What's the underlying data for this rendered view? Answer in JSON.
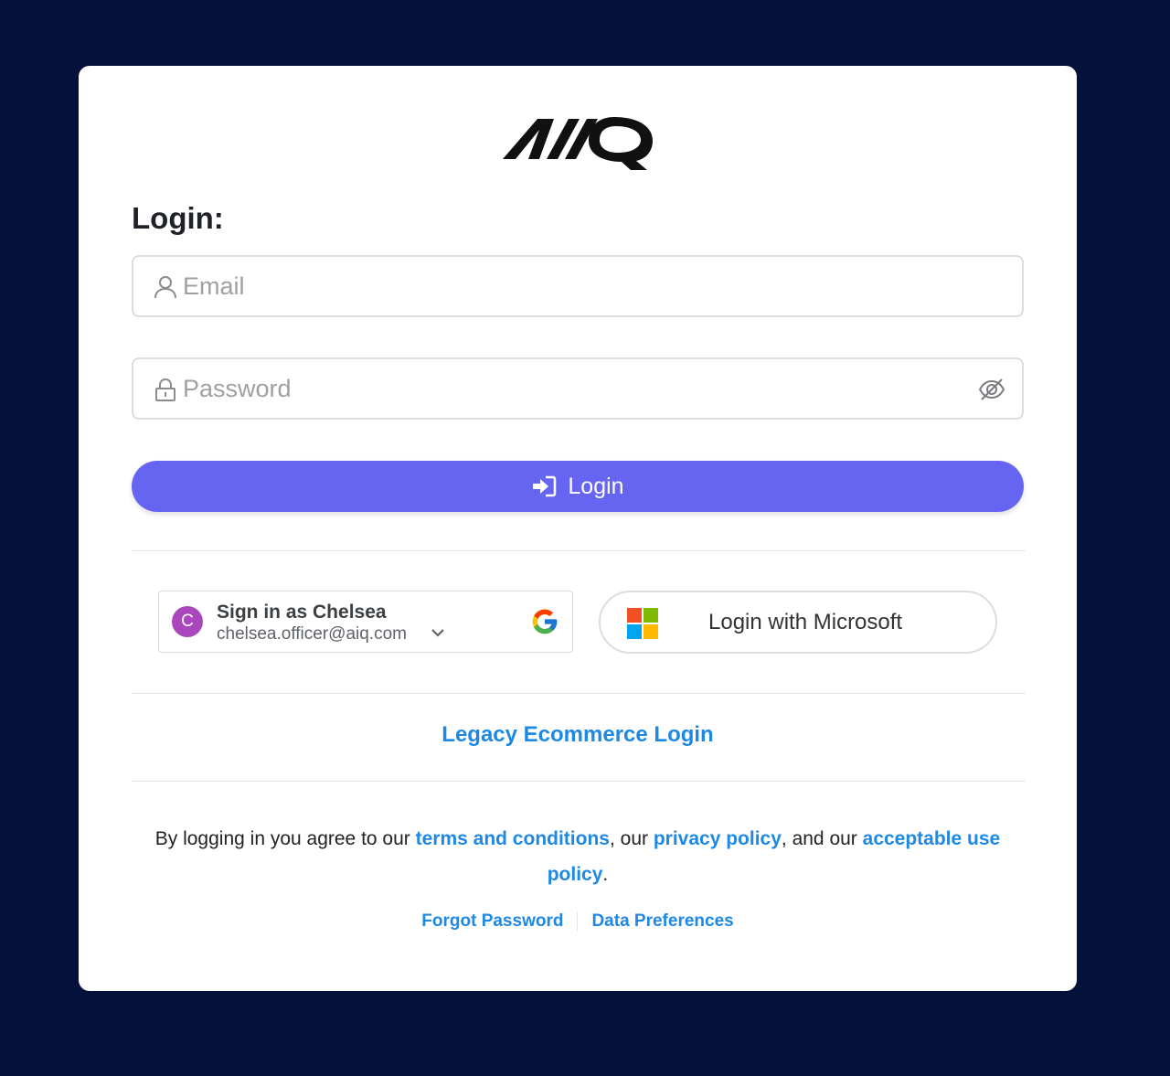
{
  "brand": {
    "logo_text": "AIQ",
    "logo_icon": "aiq-logo"
  },
  "login": {
    "heading": "Login:",
    "email_placeholder": "Email",
    "email_value": "",
    "email_icon": "user-icon",
    "password_placeholder": "Password",
    "password_value": "",
    "password_icon": "lock-icon",
    "visibility_icon": "eye-off-icon",
    "submit_label": "Login",
    "submit_icon": "sign-in-icon",
    "accent_color": "#6565f2"
  },
  "google": {
    "title": "Sign in as Chelsea",
    "email": "chelsea.officer@aiq.com",
    "avatar_initial": "C",
    "avatar_color": "#ab47bc",
    "icon": "google-icon"
  },
  "microsoft": {
    "label": "Login with Microsoft",
    "icon": "microsoft-icon"
  },
  "legacy": {
    "label": "Legacy Ecommerce Login"
  },
  "terms": {
    "prefix": "By logging in you agree to our ",
    "terms_link": "terms and conditions",
    "sep1": ", our ",
    "privacy_link": "privacy policy",
    "sep2": ", and our ",
    "aup_link": "acceptable use policy",
    "suffix": "."
  },
  "footer": {
    "forgot_password": "Forgot Password",
    "data_preferences": "Data Preferences"
  },
  "colors": {
    "background": "#04113a",
    "link": "#1e88e5"
  }
}
